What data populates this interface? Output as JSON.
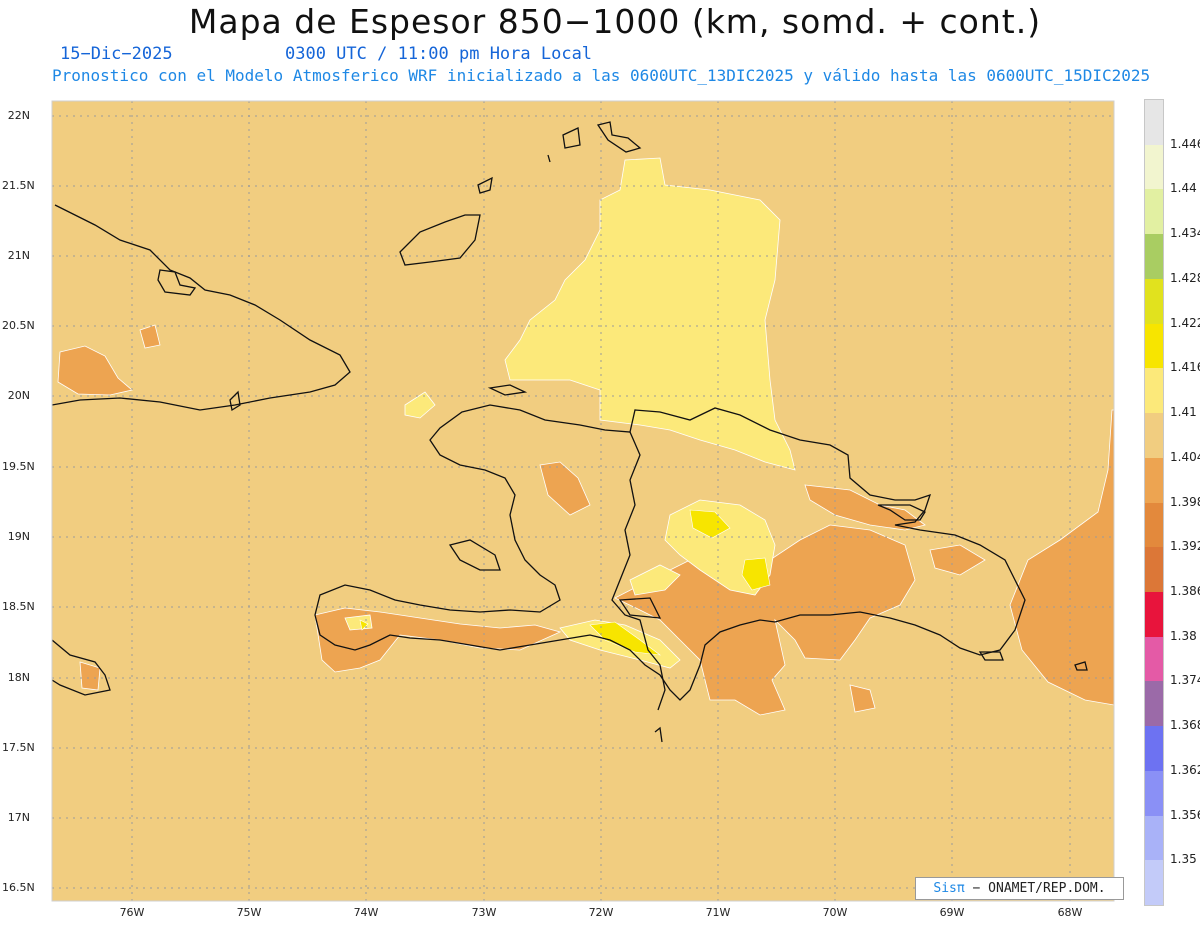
{
  "header": {
    "title": "Mapa de Espesor 850−1000 (km, somd. + cont.)",
    "date": "15−Dic−2025",
    "time": "0300 UTC / 11:00 pm Hora Local",
    "model_info": "Pronostico con el Modelo Atmosferico WRF inicializado a las 0600UTC_13DIC2025 y válido hasta las  0600UTC_15DIC2025"
  },
  "axes": {
    "lat_labels": [
      "22N",
      "21.5N",
      "21N",
      "20.5N",
      "20N",
      "19.5N",
      "19N",
      "18.5N",
      "18N",
      "17.5N",
      "17N",
      "16.5N"
    ],
    "lon_labels": [
      "76W",
      "75W",
      "74W",
      "73W",
      "72W",
      "71W",
      "70W",
      "69W",
      "68W"
    ]
  },
  "legend": {
    "labels": [
      "1.446",
      "1.44",
      "1.434",
      "1.428",
      "1.422",
      "1.416",
      "1.41",
      "1.404",
      "1.398",
      "1.392",
      "1.386",
      "1.38",
      "1.374",
      "1.368",
      "1.362",
      "1.356",
      "1.35"
    ],
    "colors": [
      "#e6e6e6",
      "#f2f5cf",
      "#e2f0a2",
      "#a9cd62",
      "#e1e21e",
      "#f7e500",
      "#fce97a",
      "#f1cd80",
      "#eda451",
      "#e3893c",
      "#dc7737",
      "#e8143c",
      "#e45aa6",
      "#9b6aa8",
      "#6d72f2",
      "#8a90f6",
      "#a9b2f8",
      "#c3cbf9"
    ]
  },
  "colors": {
    "base": "#f1cd80",
    "light_yellow": "#fce97a",
    "yellow": "#f7e500",
    "orange": "#eda451",
    "coastline": "#111111"
  },
  "credit": {
    "sis": "Sisπ",
    "org": "− ONAMET/REP.DOM."
  }
}
